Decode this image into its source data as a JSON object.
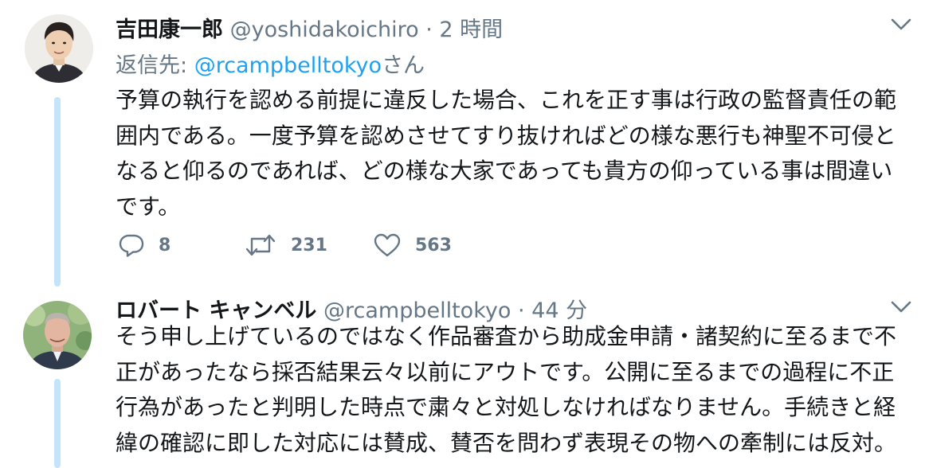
{
  "tweets": [
    {
      "name": "吉田康一郎",
      "handle": "@yoshidakoichiro",
      "separator": "·",
      "time": "2 時間",
      "reply_to_prefix": "返信先: ",
      "reply_to_mention": "@rcampbelltokyo",
      "reply_to_suffix": "さん",
      "lines": [
        "予算の執行を認める前提に違反した場合、これを正す事は行政の監督責任の範",
        "囲内である。一度予算を認めさせてすり抜ければどの様な悪行も神聖不可侵と",
        "なると仰るのであれば、どの様な大家であっても貴方の仰っている事は間違い",
        "です。"
      ],
      "actions": {
        "reply_icon": "reply-icon",
        "reply_count": "8",
        "retweet_icon": "retweet-icon",
        "retweet_count": "231",
        "like_icon": "heart-icon",
        "like_count": "563"
      }
    },
    {
      "name": "ロバート キャンベル",
      "handle": "@rcampbelltokyo",
      "separator": "·",
      "time": "44 分",
      "lines": [
        "そう申し上げているのではなく作品審査から助成金申請・諸契約に至るまで不",
        "正があったなら採否結果云々以前にアウトです。公開に至るまでの過程に不正",
        "行為があったと判明した時点で粛々と対処しなければなりません。手続きと経",
        "緯の確認に即した対応には賛成、賛否を問わず表現その物への牽制には反対。"
      ]
    }
  ],
  "colors": {
    "thread_line": "#c4e4fa",
    "link": "#1da1f2",
    "muted": "#657786",
    "text": "#14171a"
  }
}
